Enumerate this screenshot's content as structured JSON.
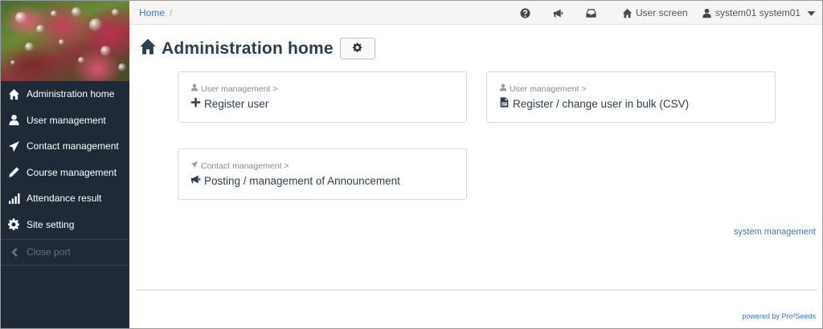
{
  "sidebar": {
    "items": [
      {
        "label": "Administration home",
        "icon": "home-icon"
      },
      {
        "label": "User management",
        "icon": "user-icon"
      },
      {
        "label": "Contact management",
        "icon": "paper-plane-icon"
      },
      {
        "label": "Course management",
        "icon": "pencil-icon"
      },
      {
        "label": "Attendance result",
        "icon": "bar-chart-icon"
      },
      {
        "label": "Site setting",
        "icon": "gear-icon"
      }
    ],
    "close_label": "Close port"
  },
  "breadcrumb": {
    "home": "Home",
    "separator": "/"
  },
  "topbar": {
    "icons": [
      "help-icon",
      "megaphone-icon",
      "inbox-icon"
    ],
    "user_screen": "User screen",
    "user_name": "system01 system01"
  },
  "page": {
    "title": "Administration home"
  },
  "cards": [
    {
      "category": "User management",
      "category_icon": "user-icon",
      "link": "Register user",
      "link_icon": "plus-icon"
    },
    {
      "category": "User management",
      "category_icon": "user-icon",
      "link": "Register / change user in bulk (CSV)",
      "link_icon": "csv-file-icon"
    },
    {
      "category": "Contact management",
      "category_icon": "paper-plane-icon",
      "link": "Posting / management of Announcement",
      "link_icon": "megaphone-icon"
    }
  ],
  "category_suffix": ">",
  "system_management": "system management",
  "footer": {
    "powered": "powered by Pro³Seeds"
  },
  "colors": {
    "sidebar_bg": "#1e2a38",
    "link": "#3b78c2",
    "title": "#2c3e50"
  }
}
